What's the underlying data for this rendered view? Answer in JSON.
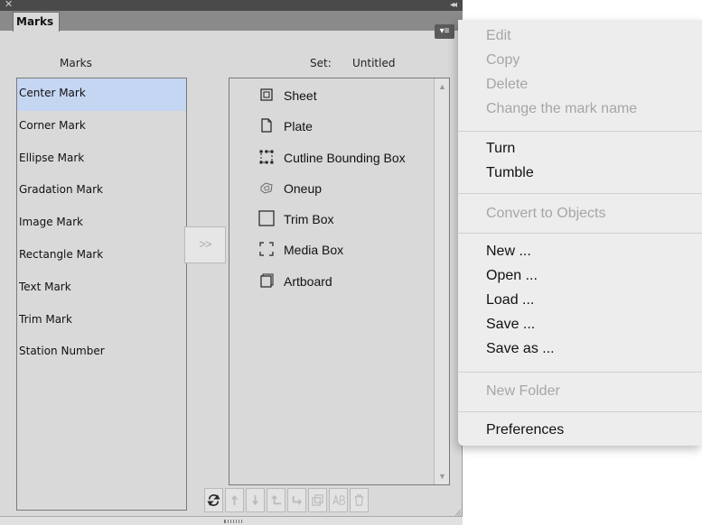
{
  "panel": {
    "tab_label": "Marks",
    "marks_header": "Marks",
    "set_label": "Set:",
    "set_value": "Untitled",
    "add_button_label": ">>"
  },
  "marks_list": [
    {
      "label": "Center Mark",
      "selected": true
    },
    {
      "label": "Corner Mark",
      "selected": false
    },
    {
      "label": "Ellipse Mark",
      "selected": false
    },
    {
      "label": "Gradation Mark",
      "selected": false
    },
    {
      "label": "Image Mark",
      "selected": false
    },
    {
      "label": "Rectangle Mark",
      "selected": false
    },
    {
      "label": "Text Mark",
      "selected": false
    },
    {
      "label": "Trim Mark",
      "selected": false
    },
    {
      "label": "Station Number",
      "selected": false
    }
  ],
  "set_list": [
    {
      "label": "Sheet",
      "icon": "sheet-icon"
    },
    {
      "label": "Plate",
      "icon": "plate-icon"
    },
    {
      "label": "Cutline Bounding Box",
      "icon": "cutline-bounding-box-icon"
    },
    {
      "label": "Oneup",
      "icon": "oneup-icon"
    },
    {
      "label": "Trim Box",
      "icon": "trim-box-icon"
    },
    {
      "label": "Media Box",
      "icon": "media-box-icon"
    },
    {
      "label": "Artboard",
      "icon": "artboard-icon"
    }
  ],
  "toolbar": [
    {
      "name": "refresh-icon",
      "enabled": true
    },
    {
      "name": "move-up-icon",
      "enabled": false
    },
    {
      "name": "move-down-icon",
      "enabled": false
    },
    {
      "name": "move-out-icon",
      "enabled": false
    },
    {
      "name": "move-in-icon",
      "enabled": false
    },
    {
      "name": "duplicate-icon",
      "enabled": false
    },
    {
      "name": "rename-icon",
      "enabled": false
    },
    {
      "name": "trash-icon",
      "enabled": false
    }
  ],
  "menu": {
    "edit": "Edit",
    "copy": "Copy",
    "delete": "Delete",
    "change_name": "Change the mark name",
    "turn": "Turn",
    "tumble": "Tumble",
    "convert": "Convert to Objects",
    "new": "New ...",
    "open": "Open ...",
    "load": "Load ...",
    "save": "Save ...",
    "save_as": "Save as ...",
    "new_folder": "New Folder",
    "preferences": "Preferences"
  },
  "colors": {
    "selection": "#c5d6f2",
    "panel_bg": "#d9d9d9",
    "menu_bg": "#ededed",
    "disabled_text": "#a6a6a6"
  }
}
